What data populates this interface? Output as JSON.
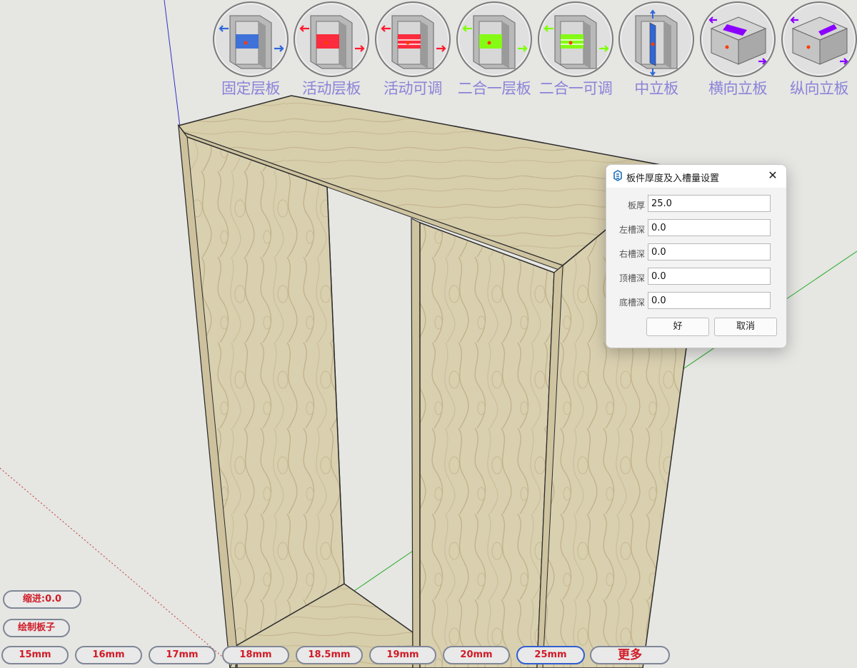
{
  "toolbar": {
    "tools": [
      {
        "label": "固定层板",
        "icon": "fixed-shelf-icon",
        "color": "#2f67d8"
      },
      {
        "label": "活动层板",
        "icon": "movable-shelf-icon",
        "color": "#ff1a2e"
      },
      {
        "label": "活动可调",
        "icon": "adjustable-shelf-icon",
        "color": "#ff1a2e"
      },
      {
        "label": "二合一层板",
        "icon": "two-in-one-shelf-icon",
        "color": "#7cff00"
      },
      {
        "label": "二合一可调",
        "icon": "two-in-one-adjustable-icon",
        "color": "#7cff00"
      },
      {
        "label": "中立板",
        "icon": "middle-divider-icon",
        "color": "#2f67d8"
      },
      {
        "label": "横向立板",
        "icon": "horizontal-panel-icon",
        "color": "#8a00ff"
      },
      {
        "label": "纵向立板",
        "icon": "vertical-panel-icon",
        "color": "#8a00ff"
      }
    ],
    "label_color": "#8a83d8"
  },
  "dialog": {
    "title": "板件厚度及入槽量设置",
    "close": "✕",
    "fields": [
      {
        "label": "板厚",
        "value": "25.0"
      },
      {
        "label": "左槽深",
        "value": "0.0"
      },
      {
        "label": "右槽深",
        "value": "0.0"
      },
      {
        "label": "顶槽深",
        "value": "0.0"
      },
      {
        "label": "底槽深",
        "value": "0.0"
      }
    ],
    "ok": "好",
    "cancel": "取消"
  },
  "bottom": {
    "indent": "缩进:0.0",
    "draw": "绘制板子",
    "thickness": [
      "15mm",
      "16mm",
      "17mm",
      "18mm",
      "18.5mm",
      "19mm",
      "20mm",
      "25mm"
    ],
    "selected": "25mm",
    "more": "更多",
    "text_color": "#d01b27"
  },
  "colors": {
    "wood": "#d8cfae",
    "background": "#e6e6e3",
    "axis_red": "#c0392b",
    "axis_green": "#22aa22",
    "axis_blue": "#2222cc"
  }
}
